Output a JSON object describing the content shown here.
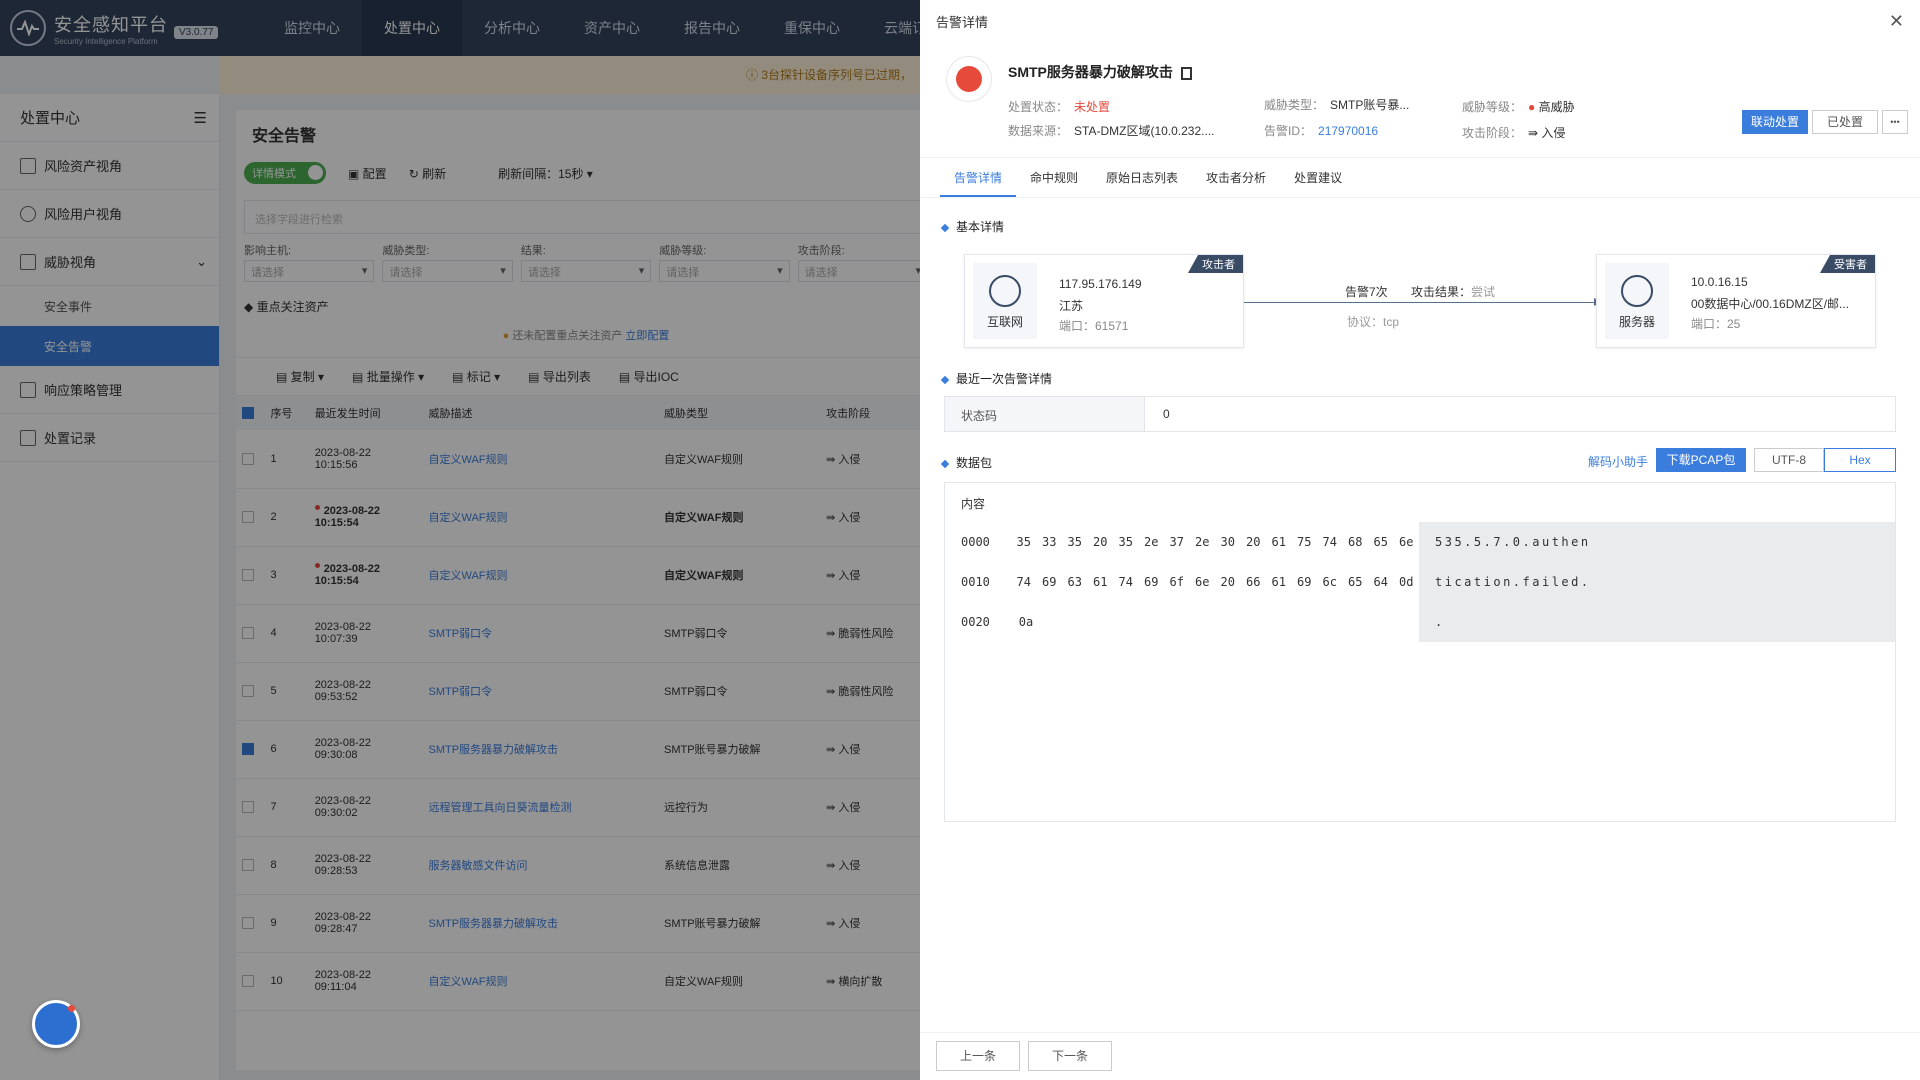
{
  "app": {
    "title": "安全感知平台",
    "subtitle": "Security Intelligence Platform",
    "version": "V3.0.77"
  },
  "topnav": [
    "监控中心",
    "处置中心",
    "分析中心",
    "资产中心",
    "报告中心",
    "重保中心",
    "云端订阅中心"
  ],
  "notice": "3台探针设备序列号已过期，",
  "sidebar": {
    "header": "处置中心",
    "items": [
      {
        "label": "风险资产视角",
        "icon": "server-icon"
      },
      {
        "label": "风险用户视角",
        "icon": "user-icon"
      },
      {
        "label": "威胁视角",
        "icon": "shield-icon"
      }
    ],
    "subitems": [
      "安全事件",
      "安全告警"
    ],
    "items_after": [
      {
        "label": "响应策略管理",
        "icon": "policy-icon"
      },
      {
        "label": "处置记录",
        "icon": "record-icon"
      }
    ]
  },
  "main": {
    "title": "安全告警",
    "toggle": "详情模式",
    "toolbar": {
      "config": "配置",
      "refresh": "刷新",
      "interval": "刷新间隔：15秒"
    },
    "search_placeholder": "选择字段进行检索",
    "filters": [
      {
        "label": "影响主机:",
        "value": "请选择"
      },
      {
        "label": "威胁类型:",
        "value": "请选择"
      },
      {
        "label": "结果:",
        "value": "请选择"
      },
      {
        "label": "威胁等级:",
        "value": "请选择"
      },
      {
        "label": "攻击阶段:",
        "value": "请选择"
      }
    ],
    "focus_title": "重点关注资产",
    "focus_note": "还未配置重点关注资产",
    "focus_link": "立即配置",
    "ops": [
      "复制",
      "批量操作",
      "标记",
      "导出列表",
      "导出IOC"
    ],
    "columns": [
      "序号",
      "最近发生时间",
      "威胁描述",
      "威胁类型",
      "攻击阶段"
    ],
    "rows": [
      {
        "no": "1",
        "date": "2023-08-22",
        "time": "10:15:56",
        "desc": "自定义WAF规则",
        "type": "自定义WAF规则",
        "stage": "入侵",
        "bold": false,
        "checked": false
      },
      {
        "no": "2",
        "date": "2023-08-22",
        "time": "10:15:54",
        "desc": "自定义WAF规则",
        "type": "自定义WAF规则",
        "stage": "入侵",
        "bold": true,
        "checked": false
      },
      {
        "no": "3",
        "date": "2023-08-22",
        "time": "10:15:54",
        "desc": "自定义WAF规则",
        "type": "自定义WAF规则",
        "stage": "入侵",
        "bold": true,
        "checked": false
      },
      {
        "no": "4",
        "date": "2023-08-22",
        "time": "10:07:39",
        "desc": "SMTP弱口令",
        "type": "SMTP弱口令",
        "stage": "脆弱性风险",
        "bold": false,
        "checked": false
      },
      {
        "no": "5",
        "date": "2023-08-22",
        "time": "09:53:52",
        "desc": "SMTP弱口令",
        "type": "SMTP弱口令",
        "stage": "脆弱性风险",
        "bold": false,
        "checked": false
      },
      {
        "no": "6",
        "date": "2023-08-22",
        "time": "09:30:08",
        "desc": "SMTP服务器暴力破解攻击",
        "type": "SMTP账号暴力破解",
        "stage": "入侵",
        "bold": false,
        "checked": true
      },
      {
        "no": "7",
        "date": "2023-08-22",
        "time": "09:30:02",
        "desc": "远程管理工具向日葵流量检测",
        "type": "远控行为",
        "stage": "入侵",
        "bold": false,
        "checked": false
      },
      {
        "no": "8",
        "date": "2023-08-22",
        "time": "09:28:53",
        "desc": "服务器敏感文件访问",
        "type": "系统信息泄露",
        "stage": "入侵",
        "bold": false,
        "checked": false
      },
      {
        "no": "9",
        "date": "2023-08-22",
        "time": "09:28:47",
        "desc": "SMTP服务器暴力破解攻击",
        "type": "SMTP账号暴力破解",
        "stage": "入侵",
        "bold": false,
        "checked": false
      },
      {
        "no": "10",
        "date": "2023-08-22",
        "time": "09:11:04",
        "desc": "自定义WAF规则",
        "type": "自定义WAF规则",
        "stage": "横向扩散",
        "bold": false,
        "checked": false
      }
    ]
  },
  "panel": {
    "title": "告警详情",
    "alert_title": "SMTP服务器暴力破解攻击",
    "fields": {
      "status_label": "处置状态：",
      "status": "未处置",
      "source_label": "数据来源：",
      "source": "STA-DMZ区域(10.0.232....",
      "threat_type_label": "威胁类型：",
      "threat_type": "SMTP账号暴...",
      "alert_id_label": "告警ID：",
      "alert_id": "217970016",
      "level_label": "威胁等级：",
      "level": "高威胁",
      "stage_label": "攻击阶段：",
      "stage": "入侵"
    },
    "buttons": {
      "linked": "联动处置",
      "handled": "已处置",
      "more": "•••"
    },
    "tabs": [
      "告警详情",
      "命中规则",
      "原始日志列表",
      "攻击者分析",
      "处置建议"
    ],
    "basic_title": "基本详情",
    "attacker": {
      "tag": "攻击者",
      "icon_label": "互联网",
      "ip": "117.95.176.149",
      "region": "江苏",
      "port": "端口：61571"
    },
    "victim": {
      "tag": "受害者",
      "icon_label": "服务器",
      "ip": "10.0.16.15",
      "location": "00数据中心/00.16DMZ区/邮...",
      "port": "端口：25"
    },
    "link": {
      "count": "告警7次",
      "result_label": "攻击结果：",
      "result": "尝试",
      "protocol": "协议：tcp"
    },
    "recent_title": "最近一次告警详情",
    "status_code_label": "状态码",
    "status_code": "0",
    "packet_title": "数据包",
    "packet_tools": {
      "decode": "解码小助手",
      "download": "下载PCAP包",
      "utf8": "UTF-8",
      "hex": "Hex"
    },
    "packet_head": "内容",
    "hex_rows": [
      {
        "offset": "0000",
        "bytes": [
          "35",
          "33",
          "35",
          "20",
          "35",
          "2e",
          "37",
          "2e",
          "30",
          "20",
          "61",
          "75",
          "74",
          "68",
          "65",
          "6e"
        ],
        "ascii": "535.5.7.0.authen"
      },
      {
        "offset": "0010",
        "bytes": [
          "74",
          "69",
          "63",
          "61",
          "74",
          "69",
          "6f",
          "6e",
          "20",
          "66",
          "61",
          "69",
          "6c",
          "65",
          "64",
          "0d"
        ],
        "ascii": "tication.failed."
      },
      {
        "offset": "0020",
        "bytes": [
          "0a"
        ],
        "ascii": "."
      }
    ],
    "footer": {
      "prev": "上一条",
      "next": "下一条"
    }
  }
}
